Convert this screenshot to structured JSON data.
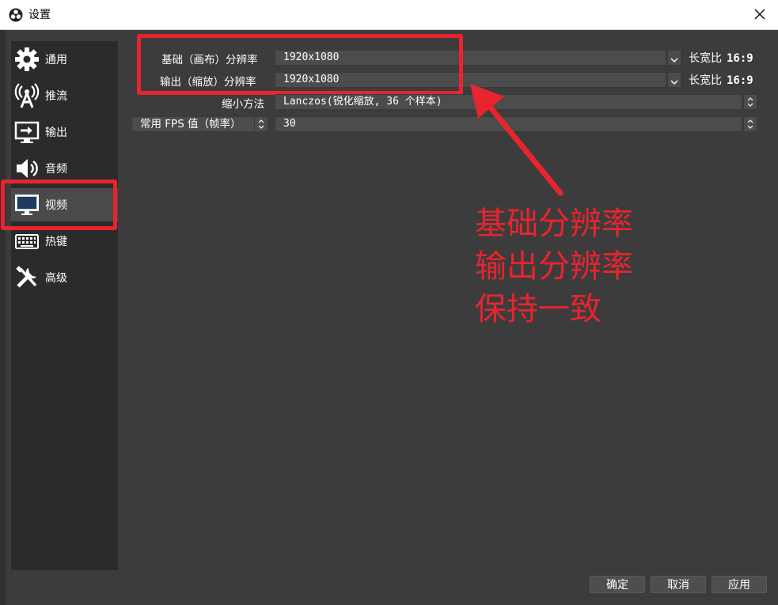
{
  "window": {
    "title": "设置"
  },
  "colors": {
    "annotation": "#e8242e",
    "active_nav": "#4a4a4a",
    "sidebar": "#2b2b2b",
    "background": "#3c3c3c"
  },
  "sidebar": {
    "items": [
      {
        "label": "通用",
        "icon": "gear-icon"
      },
      {
        "label": "推流",
        "icon": "broadcast-icon"
      },
      {
        "label": "输出",
        "icon": "output-icon"
      },
      {
        "label": "音频",
        "icon": "speaker-icon"
      },
      {
        "label": "视频",
        "icon": "monitor-icon",
        "active": true
      },
      {
        "label": "热键",
        "icon": "keyboard-icon"
      },
      {
        "label": "高级",
        "icon": "tools-icon"
      }
    ]
  },
  "video": {
    "base_resolution": {
      "label": "基础（画布）分辨率",
      "value": "1920x1080",
      "aspect_label": "长宽比",
      "aspect_value": "16:9"
    },
    "output_resolution": {
      "label": "输出（缩放）分辨率",
      "value": "1920x1080",
      "aspect_label": "长宽比",
      "aspect_value": "16:9"
    },
    "downscale_filter": {
      "label": "缩小方法",
      "value": "Lanczos(锐化缩放, 36 个样本)"
    },
    "fps": {
      "label": "常用 FPS 值（帧率）",
      "value": "30"
    }
  },
  "annotation": {
    "lines": [
      "基础分辨率",
      "输出分辨率",
      "保持一致"
    ]
  },
  "footer": {
    "ok": "确定",
    "cancel": "取消",
    "apply": "应用"
  }
}
